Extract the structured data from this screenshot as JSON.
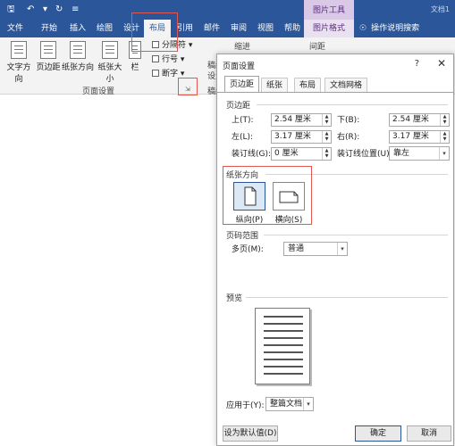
{
  "titlebar": {
    "icons": [
      "save-icon",
      "undo-icon",
      "redo-icon",
      "customize-icon"
    ],
    "picture_tools": "图片工具",
    "doc_title": "文档1"
  },
  "tabs": {
    "file": "文件",
    "home": "开始",
    "insert": "插入",
    "draw": "绘图",
    "design": "设计",
    "layout": "布局",
    "references": "引用",
    "mailings": "邮件",
    "review": "审阅",
    "view": "视图",
    "help": "帮助",
    "format": "图片格式",
    "tell_me": "操作说明搜索"
  },
  "ribbon": {
    "text_direction": "文字方向",
    "margins": "页边距",
    "orientation": "纸张方向",
    "size": "纸张大小",
    "columns": "栏",
    "breaks": "分隔符",
    "line_numbers": "行号",
    "hyphenation": "断字",
    "group_page_setup": "页面设置",
    "indent": "缩进",
    "spacing": "间距",
    "partial_left": "稿纸",
    "partial_left2": "设置",
    "partial_left3": "稿纸"
  },
  "dialog": {
    "title": "页面设置",
    "help": "?",
    "close": "✕",
    "tabs": [
      "页边距",
      "纸张",
      "布局",
      "文档网格"
    ],
    "margins_section": "页边距",
    "top_label": "上(T):",
    "top_value": "2.54 厘米",
    "bottom_label": "下(B):",
    "bottom_value": "2.54 厘米",
    "left_label": "左(L):",
    "left_value": "3.17 厘米",
    "right_label": "右(R):",
    "right_value": "3.17 厘米",
    "gutter_label": "装订线(G):",
    "gutter_value": "0 厘米",
    "gutter_pos_label": "装订线位置(U):",
    "gutter_pos_value": "靠左",
    "orientation_section": "纸张方向",
    "portrait": "纵向(P)",
    "landscape": "横向(S)",
    "pages_section": "页码范围",
    "multiple_pages_label": "多页(M):",
    "multiple_pages_value": "普通",
    "preview_section": "预览",
    "apply_label": "应用于(Y):",
    "apply_value": "整篇文档",
    "set_default": "设为默认值(D)",
    "ok": "确定",
    "cancel": "取消"
  },
  "colors": {
    "accent": "#2b579a",
    "picture_tools": "#d9c8e6",
    "highlight": "#e0584f"
  }
}
